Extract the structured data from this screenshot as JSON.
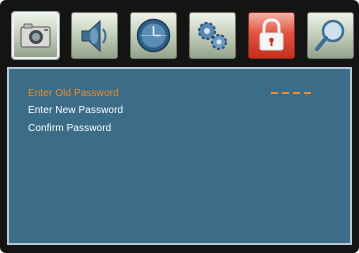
{
  "toolbar": {
    "tabs": [
      {
        "id": "picture",
        "icon": "camera-icon",
        "active": true
      },
      {
        "id": "audio",
        "icon": "speaker-icon",
        "active": false
      },
      {
        "id": "time",
        "icon": "clock-icon",
        "active": false
      },
      {
        "id": "setup",
        "icon": "gears-icon",
        "active": false
      },
      {
        "id": "lock",
        "icon": "padlock-icon",
        "active": false
      },
      {
        "id": "search",
        "icon": "magnifier-icon",
        "active": false
      }
    ]
  },
  "password_menu": {
    "items": [
      {
        "label": "Enter Old  Password",
        "selected": true
      },
      {
        "label": "Enter New Password",
        "selected": false
      },
      {
        "label": "Confirm Password",
        "selected": false
      }
    ],
    "old_password_entry": "----"
  },
  "colors": {
    "panel": "#3b6d88",
    "highlight": "#f08a2a",
    "text": "#ffffff",
    "frame": "#141414"
  }
}
